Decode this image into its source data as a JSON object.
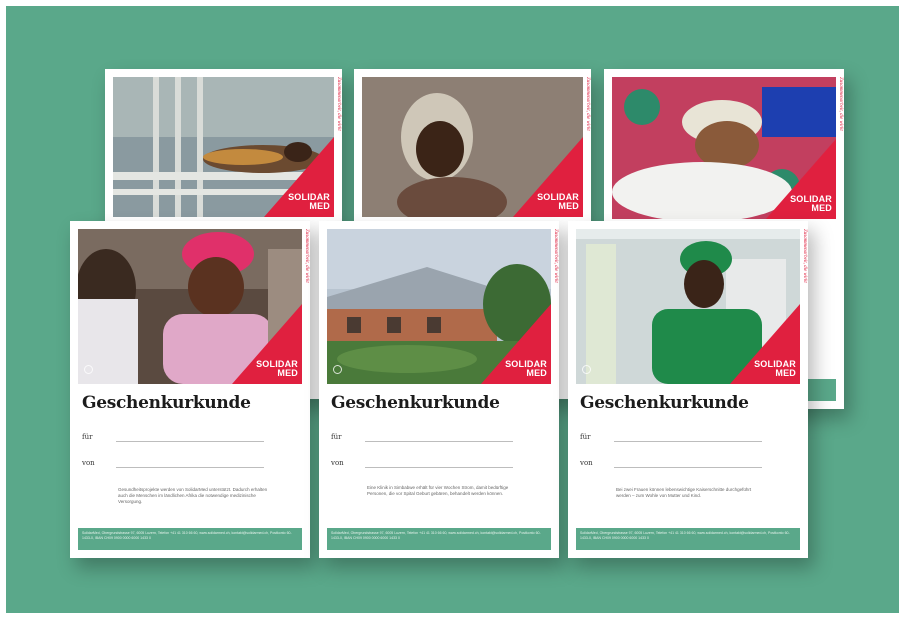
{
  "cards": [
    {
      "title": "Geschenkurkunde",
      "fuer_label": "für",
      "von_label": "von",
      "logo_line1": "SOLIDAR",
      "logo_line2": "MED",
      "tagline": "Zusammenarbeit, die wirkt",
      "body": "Gesundheitsprojekte werden von SolidarMed unterstützt. Dadurch erhalten auch die Menschen im ländlichen Afrika die notwendige medizinische Versorgung.",
      "footer": "SolidarMed, Obergrundstrasse 97, 6005 Luzern, Telefon +41 41 310 66 60, www.solidarmed.ch, kontakt@solidarmed.ch, Postkonto 60-1433-0, IBAN CH09 0900 0000 6000 1433 0"
    },
    {
      "title": "Geschenkurkunde",
      "fuer_label": "für",
      "von_label": "von",
      "logo_line1": "SOLIDAR",
      "logo_line2": "MED",
      "tagline": "Zusammenarbeit, die wirkt",
      "body": "Eine Klinik in Simbabwe erhält für vier Wochen Strom, damit bedürftige Personen, die vor Spital Geburt gebären, behandelt werden können.",
      "footer": "SolidarMed, Obergrundstrasse 97, 6005 Luzern, Telefon +41 41 310 66 60, www.solidarmed.ch, kontakt@solidarmed.ch, Postkonto 60-1433-0, IBAN CH09 0900 0000 6000 1433 0"
    },
    {
      "title": "Geschenkurkunde",
      "fuer_label": "für",
      "von_label": "von",
      "logo_line1": "SOLIDAR",
      "logo_line2": "MED",
      "tagline": "Zusammenarbeit, die wirkt",
      "body": "Bei zwei Frauen können lebenswichtige Kaiserschnitte durchgeführt werden – zum Wohle von Mutter und Kind.",
      "footer": "SolidarMed, Obergrundstrasse 97, 6005 Luzern, Telefon +41 41 310 66 60, www.solidarmed.ch, kontakt@solidarmed.ch, Postkonto 60-1433-0, IBAN CH09 0900 0000 6000 1433 0"
    }
  ],
  "back_cards": [
    {
      "logo_line1": "SOLIDAR",
      "logo_line2": "MED",
      "tagline": "Zusammenarbeit, die wirkt"
    },
    {
      "logo_line1": "SOLIDAR",
      "logo_line2": "MED",
      "tagline": "Zusammenarbeit, die wirkt"
    },
    {
      "logo_line1": "SOLIDAR",
      "logo_line2": "MED",
      "tagline": "Zusammenarbeit, die wirkt"
    }
  ],
  "colors": {
    "background": "#5aa88a",
    "brand_red": "#e0203f",
    "footer_green": "#5aa88a"
  }
}
